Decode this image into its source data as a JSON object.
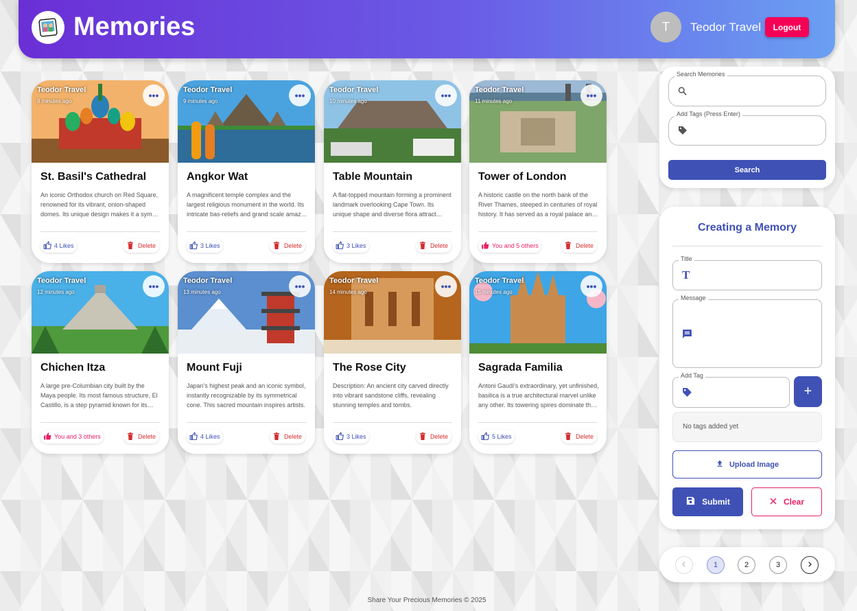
{
  "header": {
    "title": "Memories",
    "avatar_initial": "T",
    "user_name": "Teodor Travel",
    "logout_label": "Logout",
    "logo_icon": "photo-album-icon"
  },
  "posts": [
    {
      "author": "Teodor Travel",
      "time": "8 minutes ago",
      "title": "St. Basil's Cathedral",
      "message": "An iconic Orthodox church on Red Square, renowned for its vibrant, onion-shaped domes. Its unique design makes it a symbol of Russia.",
      "likes": "4 Likes",
      "liked_by_me": false,
      "delete_label": "Delete"
    },
    {
      "author": "Teodor Travel",
      "time": "9 minutes ago",
      "title": "Angkor Wat",
      "message": "A magnificent temple complex and the largest religious monument in the world. Its intricate bas-reliefs and grand scale amaze visitors.",
      "likes": "3 Likes",
      "liked_by_me": false,
      "delete_label": "Delete"
    },
    {
      "author": "Teodor Travel",
      "time": "10 minutes ago",
      "title": "Table Mountain",
      "message": "A flat-topped mountain forming a prominent landmark overlooking Cape Town. Its unique shape and diverse flora attract hikers.",
      "likes": "3 Likes",
      "liked_by_me": false,
      "delete_label": "Delete"
    },
    {
      "author": "Teodor Travel",
      "time": "11 minutes ago",
      "title": "Tower of London",
      "message": "A historic castle on the north bank of the River Thames, steeped in centuries of royal history. It has served as a royal palace and prison.",
      "likes": "You and 5 others",
      "liked_by_me": true,
      "delete_label": "Delete"
    },
    {
      "author": "Teodor Travel",
      "time": "12 minutes ago",
      "title": "Chichen Itza",
      "message": "A large pre-Columbian city built by the Maya people. Its most famous structure, El Castillo, is a step pyramid known for its precision.",
      "likes": "You and 3 others",
      "liked_by_me": true,
      "delete_label": "Delete"
    },
    {
      "author": "Teodor Travel",
      "time": "13 minutes ago",
      "title": "Mount Fuji",
      "message": "Japan's highest peak and an iconic symbol, instantly recognizable by its symmetrical cone. This sacred mountain inspires artists.",
      "likes": "4 Likes",
      "liked_by_me": false,
      "delete_label": "Delete"
    },
    {
      "author": "Teodor Travel",
      "time": "14 minutes ago",
      "title": "The Rose City",
      "message": "Description: An ancient city carved directly into vibrant sandstone cliffs, revealing stunning temples and tombs.",
      "likes": "3 Likes",
      "liked_by_me": false,
      "delete_label": "Delete"
    },
    {
      "author": "Teodor Travel",
      "time": "15 minutes ago",
      "title": "Sagrada Familia",
      "message": "Antoni Gaudi's extraordinary, yet unfinished, basilica is a true architectural marvel unlike any other. Its towering spires dominate the skyline.",
      "likes": "5 Likes",
      "liked_by_me": false,
      "delete_label": "Delete"
    }
  ],
  "search": {
    "search_label": "Search Memories",
    "search_value": "",
    "tags_label": "Add Tags (Press Enter)",
    "tags_value": "",
    "button_label": "Search"
  },
  "form": {
    "heading": "Creating a Memory",
    "title_label": "Title",
    "message_label": "Message",
    "tag_label": "Add Tag",
    "add_button": "+",
    "no_tags": "No tags added yet",
    "upload_label": "Upload Image",
    "submit_label": "Submit",
    "clear_label": "Clear"
  },
  "pagination": {
    "pages": [
      "1",
      "2",
      "3"
    ],
    "current": "1"
  },
  "footer": "Share Your Precious Memories © 2025",
  "colors": {
    "primary": "#3f51b5",
    "accent": "#f50057",
    "danger": "#d32f2f",
    "liked": "#e91e63"
  }
}
